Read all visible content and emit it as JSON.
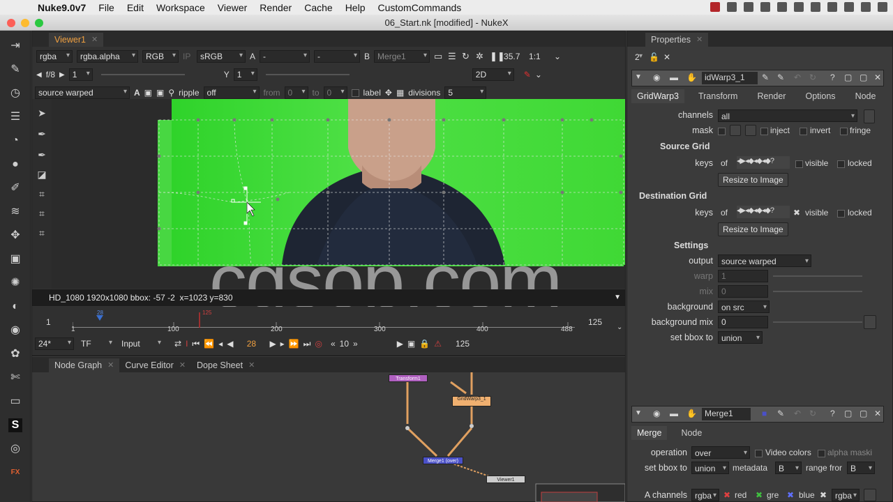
{
  "menubar": {
    "app": "Nuke9.0v7",
    "items": [
      "File",
      "Edit",
      "Workspace",
      "Viewer",
      "Render",
      "Cache",
      "Help",
      "CustomCommands"
    ]
  },
  "window": {
    "title": "06_Start.nk [modified] - NukeX"
  },
  "viewer": {
    "tab": "Viewer1",
    "channels": "rgba",
    "alpha": "rgba.alpha",
    "colorspace_mode": "RGB",
    "lut": "sRGB",
    "a_label": "A",
    "a_input": "-",
    "mid_input": "-",
    "b_label": "B",
    "b_input": "Merge1",
    "zoom": "35.7",
    "ratio": "1:1",
    "fstop": "f/8",
    "gain": "1",
    "gamma_label": "Y",
    "gamma": "1",
    "view_mode": "2D",
    "overlay_output": "source warped",
    "ripple_label": "ripple",
    "ripple_value": "off",
    "from_label": "from",
    "from_value": "0",
    "to_label": "to",
    "to_value": "0",
    "label_label": "label",
    "divisions_label": "divisions",
    "divisions_value": "5",
    "info": "HD_1080 1920x1080  bbox: -57 -2  x=1023 y=830"
  },
  "timeline": {
    "start": "1",
    "end": "125",
    "ticks": [
      "1",
      "100",
      "200",
      "300",
      "400",
      "488"
    ],
    "current_marker": "125",
    "marker28": "28",
    "fps": "24*",
    "tf": "TF",
    "input": "Input",
    "frame": "28",
    "step": "10",
    "end2": "125"
  },
  "nodegraph": {
    "tabs": [
      "Node Graph",
      "Curve Editor",
      "Dope Sheet"
    ],
    "nodes": [
      "Transform1",
      "GridWarp3_1",
      "Merge1 (over)",
      "Viewer1"
    ]
  },
  "properties": {
    "tab": "Properties",
    "count": "2",
    "node1": {
      "name": "idWarp3_1",
      "tabs": [
        "GridWarp3",
        "Transform",
        "Render",
        "Options",
        "Node"
      ],
      "channels_label": "channels",
      "channels": "all",
      "mask_label": "mask",
      "inject": "inject",
      "invert": "invert",
      "fringe": "fringe",
      "source_grid": "Source Grid",
      "keys_label": "keys",
      "of": "of",
      "visible": "visible",
      "locked": "locked",
      "resize": "Resize to Image",
      "dest_grid": "Destination Grid",
      "settings": "Settings",
      "output_label": "output",
      "output": "source warped",
      "warp_label": "warp",
      "warp": "1",
      "mix_label": "mix",
      "mix": "0",
      "background_label": "background",
      "background": "on src",
      "bgmix_label": "background mix",
      "bgmix": "0",
      "bbox_label": "set bbox to",
      "bbox": "union"
    },
    "node2": {
      "name": "Merge1",
      "tabs": [
        "Merge",
        "Node"
      ],
      "operation_label": "operation",
      "operation": "over",
      "video_colors": "Video colors",
      "alpha_masking": "alpha maski",
      "bbox_label": "set bbox to",
      "bbox": "union",
      "metadata_label": "metadata",
      "metadata": "B",
      "range_label": "range fror",
      "range": "B",
      "achannels_label": "A channels",
      "achannels": "rgba",
      "red": "red",
      "green": "gre",
      "blue": "blue",
      "bchannels": "rgba"
    }
  },
  "watermark": "cgsop.com"
}
